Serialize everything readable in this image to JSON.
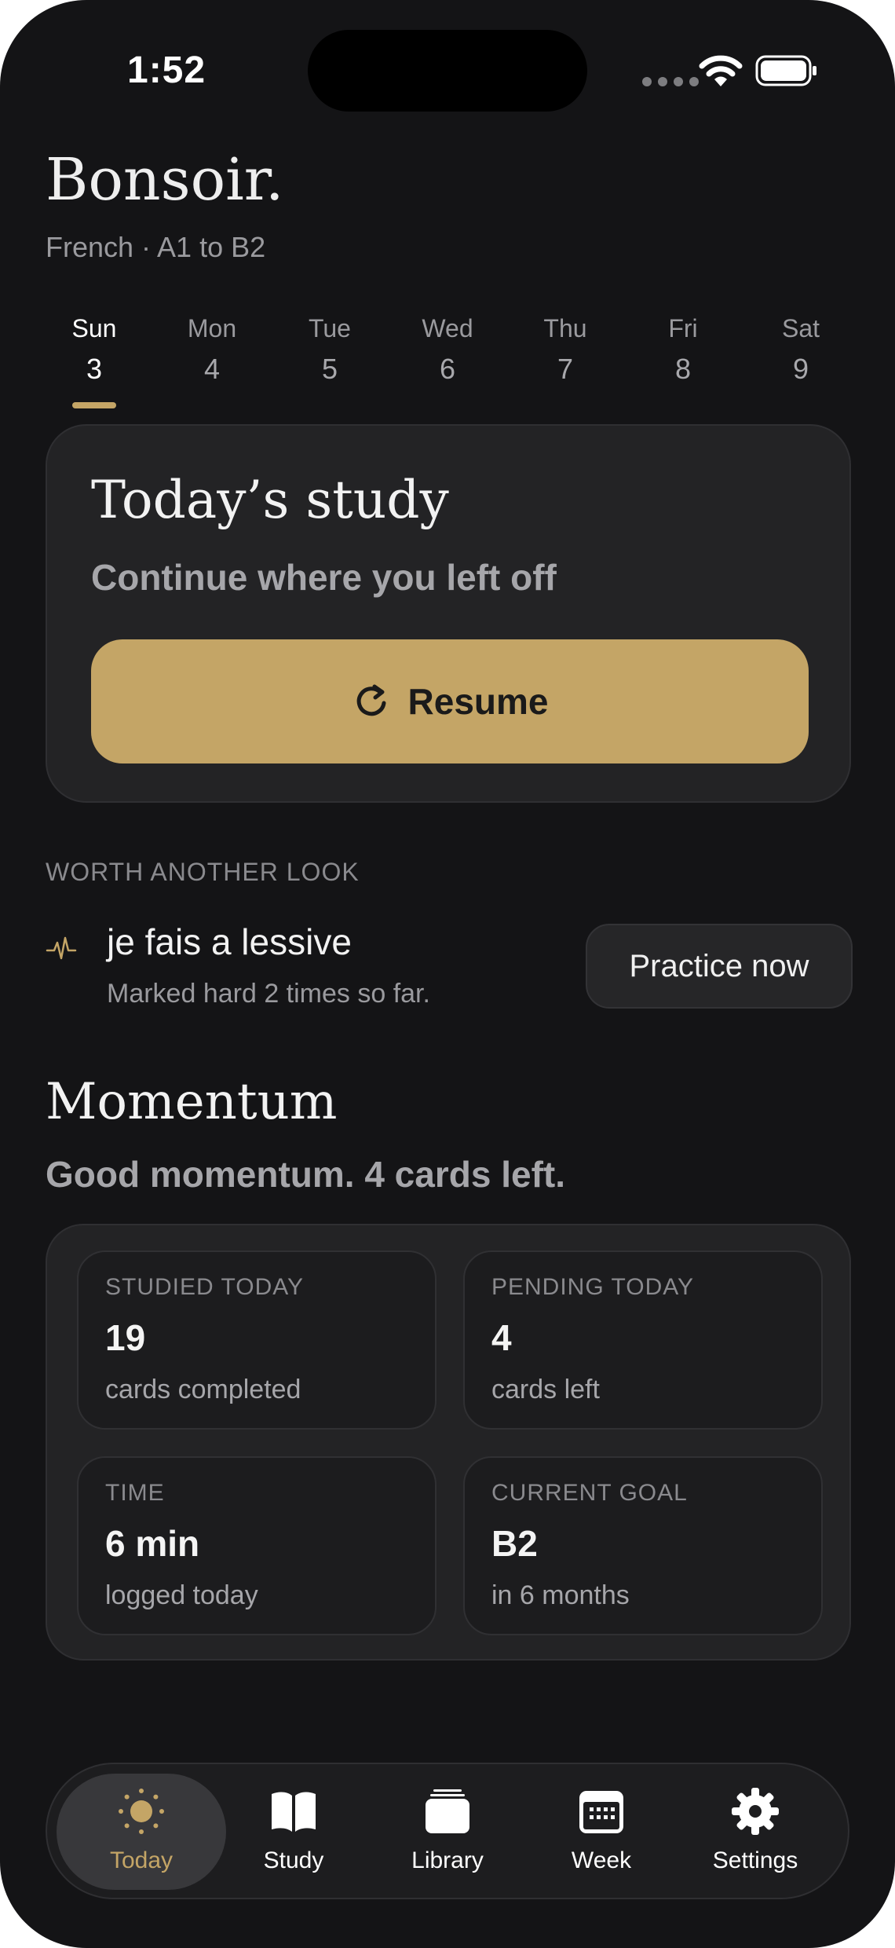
{
  "status": {
    "time": "1:52"
  },
  "header": {
    "greeting": "Bonsoir.",
    "subtitle": "French · A1 to B2"
  },
  "week": [
    {
      "name": "Sun",
      "date": "3",
      "active": true
    },
    {
      "name": "Mon",
      "date": "4"
    },
    {
      "name": "Tue",
      "date": "5"
    },
    {
      "name": "Wed",
      "date": "6"
    },
    {
      "name": "Thu",
      "date": "7"
    },
    {
      "name": "Fri",
      "date": "8"
    },
    {
      "name": "Sat",
      "date": "9"
    }
  ],
  "study_card": {
    "title": "Today’s study",
    "subtitle": "Continue where you left off",
    "button_label": "Resume"
  },
  "worth_another_look": {
    "section_label": "WORTH ANOTHER LOOK",
    "phrase": "je fais a lessive",
    "note": "Marked hard 2 times so far.",
    "button_label": "Practice now"
  },
  "momentum": {
    "title": "Momentum",
    "subtitle": "Good momentum. 4 cards left.",
    "tiles": [
      {
        "label": "STUDIED TODAY",
        "value": "19",
        "sub": "cards completed"
      },
      {
        "label": "PENDING TODAY",
        "value": "4",
        "sub": "cards left"
      },
      {
        "label": "TIME",
        "value": "6 min",
        "sub": "logged today"
      },
      {
        "label": "CURRENT GOAL",
        "value": "B2",
        "sub": "in 6 months"
      }
    ]
  },
  "tabs": [
    {
      "label": "Today",
      "icon": "sun-icon",
      "active": true
    },
    {
      "label": "Study",
      "icon": "book-icon"
    },
    {
      "label": "Library",
      "icon": "cards-icon"
    },
    {
      "label": "Week",
      "icon": "calendar-icon"
    },
    {
      "label": "Settings",
      "icon": "gear-icon"
    }
  ],
  "colors": {
    "accent": "#c4a566",
    "background": "#141416",
    "card": "#232325"
  }
}
